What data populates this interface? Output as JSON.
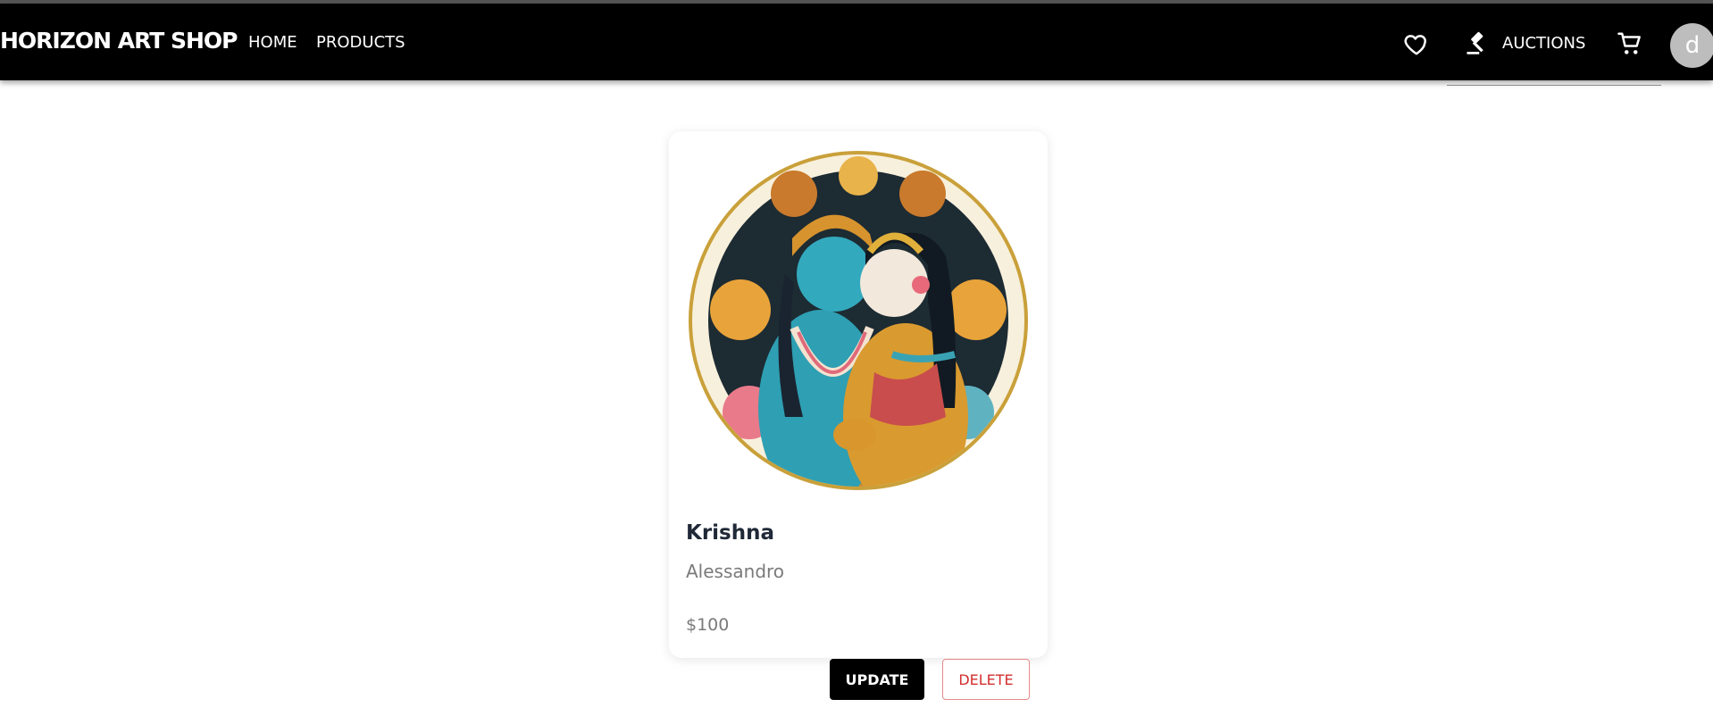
{
  "header": {
    "brand": "HORIZON ART SHOP",
    "nav": [
      {
        "label": "HOME"
      },
      {
        "label": "PRODUCTS"
      }
    ],
    "auctions_label": "AUCTIONS",
    "avatar_initial": "d",
    "icons": [
      "heart-icon",
      "gavel-icon",
      "cart-icon"
    ]
  },
  "product": {
    "title": "Krishna",
    "artist": "Alessandro",
    "price": "$100",
    "image_alt": "Krishna and Radha illustration"
  },
  "actions": {
    "update_label": "UPDATE",
    "delete_label": "DELETE"
  },
  "colors": {
    "navbar": "#000000",
    "accent_danger": "#d32f2f",
    "avatar_bg": "#bdbdbd"
  }
}
